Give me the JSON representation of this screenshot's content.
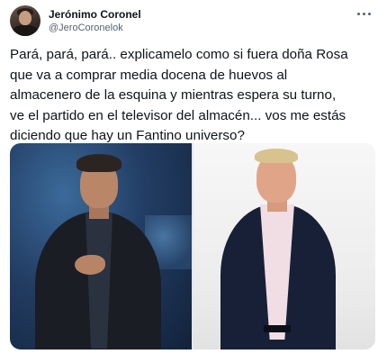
{
  "tweet": {
    "author": {
      "display_name": "Jerónimo Coronel",
      "handle": "@JeroCoronelok"
    },
    "text_lines": [
      "Pará, pará, pará.. explicamelo como si fuera doña Rosa",
      "que va a comprar media docena de huevos al",
      "almacenero de la esquina y mientras espera su turno,",
      "ve el partido en el televisor del almacén... vos me estás",
      "diciendo que hay un Fantino universo?"
    ],
    "media": [
      {
        "kind": "photo",
        "subject": "man-in-dark-suit-at-stadium"
      },
      {
        "kind": "photo",
        "subject": "man-in-navy-suit-pink-shirt"
      }
    ]
  },
  "colors": {
    "text_primary": "#0f1419",
    "text_secondary": "#536471",
    "background": "#ffffff"
  },
  "icons": {
    "more": "more-horizontal-icon"
  }
}
